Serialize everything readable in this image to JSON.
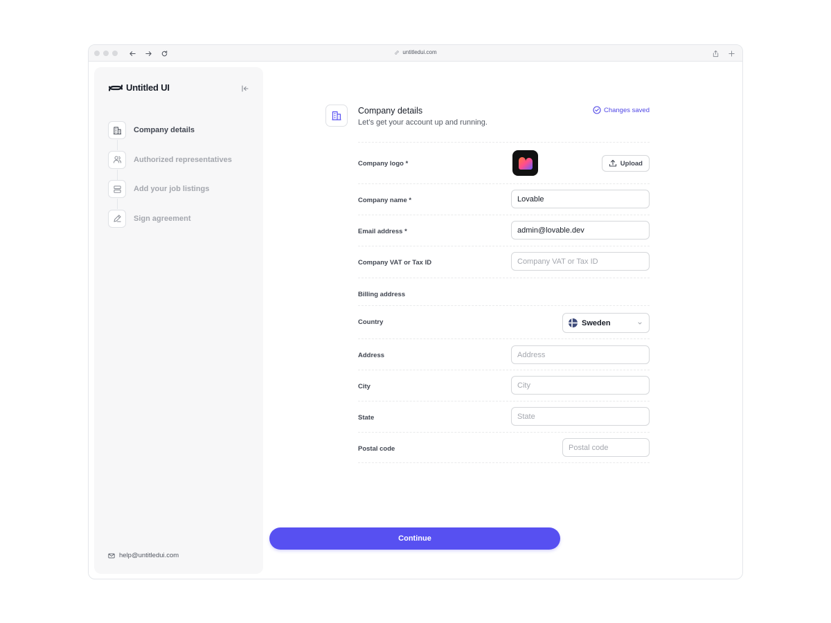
{
  "browser": {
    "url": "untitledui.com"
  },
  "sidebar": {
    "brand": "Untitled UI",
    "steps": [
      {
        "label": "Company details",
        "icon": "building-icon",
        "active": true
      },
      {
        "label": "Authorized representatives",
        "icon": "users-icon",
        "active": false
      },
      {
        "label": "Add your job listings",
        "icon": "list-icon",
        "active": false
      },
      {
        "label": "Sign agreement",
        "icon": "pen-icon",
        "active": false
      }
    ],
    "help_email": "help@untitledui.com"
  },
  "header": {
    "title": "Company details",
    "subtitle": "Let’s get your account up and running.",
    "status": "Changes saved"
  },
  "form": {
    "logo": {
      "label": "Company logo",
      "required": "*",
      "button": "Upload"
    },
    "company_name": {
      "label": "Company name",
      "required": "*",
      "value": "Lovable"
    },
    "email": {
      "label": "Email address",
      "required": "*",
      "value": "admin@lovable.dev"
    },
    "vat": {
      "label": "Company VAT or Tax ID",
      "placeholder": "Company VAT or Tax ID"
    },
    "billing_heading": "Billing address",
    "country": {
      "label": "Country",
      "value": "Sweden"
    },
    "address": {
      "label": "Address",
      "placeholder": "Address"
    },
    "city": {
      "label": "City",
      "placeholder": "City"
    },
    "state": {
      "label": "State",
      "placeholder": "State"
    },
    "postal": {
      "label": "Postal code",
      "placeholder": "Postal code"
    }
  },
  "actions": {
    "continue": "Continue"
  },
  "colors": {
    "accent": "#5750f1",
    "status": "#4f46e5"
  }
}
